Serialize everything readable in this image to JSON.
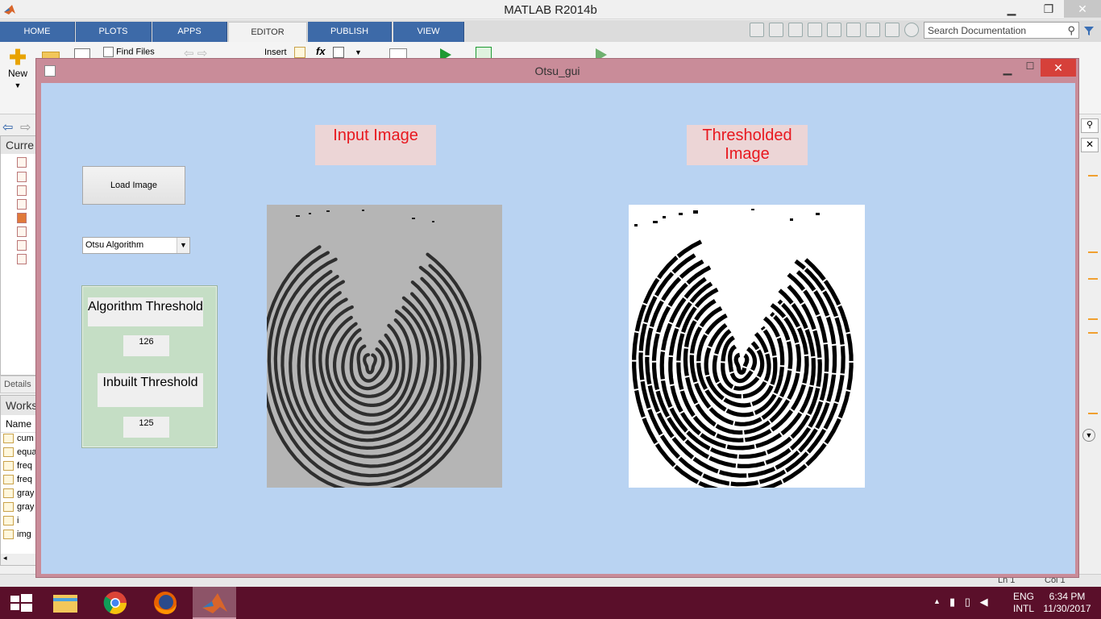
{
  "matlab": {
    "window_title": "MATLAB R2014b",
    "tabs": [
      "HOME",
      "PLOTS",
      "APPS",
      "EDITOR",
      "PUBLISH",
      "VIEW"
    ],
    "active_tab": "EDITOR",
    "search_placeholder": "Search Documentation",
    "toolstrip": {
      "new_label": "New",
      "find_files_label": "Find Files",
      "insert_label": "Insert",
      "fx_label": "fx"
    },
    "current_folder_header": "Curre",
    "details_label": "Details",
    "workspace_header": "Works",
    "workspace_col_name": "Name",
    "workspace_rows": [
      "cum",
      "equa",
      "freq",
      "freq",
      "gray",
      "gray",
      "i",
      "img"
    ],
    "status": {
      "ln": "Ln 1",
      "col": "Col 1"
    }
  },
  "gui": {
    "window_title": "Otsu_gui",
    "input_image_title": "Input Image",
    "thresholded_image_title_line1": "Thresholded",
    "thresholded_image_title_line2": "Image",
    "load_button_label": "Load Image",
    "algorithm_selected": "Otsu Algorithm",
    "algorithm_threshold_label": "Algorithm Threshold",
    "algorithm_threshold_value": "126",
    "inbuilt_threshold_label": "Inbuilt Threshold",
    "inbuilt_threshold_value": "125"
  },
  "taskbar": {
    "language_line1": "ENG",
    "language_line2": "INTL",
    "time": "6:34 PM",
    "date": "11/30/2017"
  },
  "colors": {
    "gui_background": "#b9d3f2",
    "gui_frame": "#c98c99",
    "title_text": "#e8181f",
    "title_box": "#ecd5d6",
    "threshold_panel": "#c5dec5",
    "taskbar": "#5a0f2a",
    "matlab_tab": "#3d6aa8"
  }
}
